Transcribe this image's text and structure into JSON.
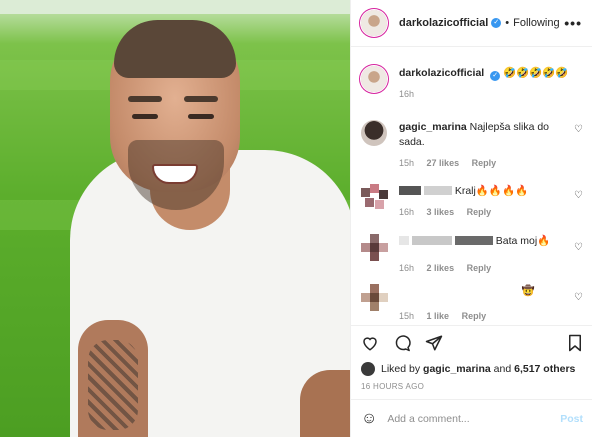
{
  "header": {
    "username": "darkolazicofficial",
    "verified_icon": "verified-badge-icon",
    "separator": "•",
    "follow_status": "Following",
    "more_label": "•••"
  },
  "caption": {
    "username": "darkolazicofficial",
    "text": "🤣🤣🤣🤣🤣",
    "time": "16h"
  },
  "comments": [
    {
      "username": "gagic_marina",
      "text": "Najlepša slika do sada.",
      "time": "15h",
      "likes": "27 likes",
      "reply": "Reply"
    },
    {
      "username": "",
      "text": "Kralj🔥🔥🔥🔥",
      "time": "16h",
      "likes": "3 likes",
      "reply": "Reply"
    },
    {
      "username": "",
      "text": "Bata moj🔥",
      "time": "16h",
      "likes": "2 likes",
      "reply": "Reply"
    },
    {
      "username": "",
      "text": "🤠",
      "time": "15h",
      "likes": "1 like",
      "reply": "Reply"
    }
  ],
  "likes": {
    "prefix": "Liked by",
    "user": "gagic_marina",
    "and": "and",
    "others": "6,517 others"
  },
  "timestamp": "16 HOURS AGO",
  "add_comment": {
    "placeholder": "Add a comment...",
    "post_label": "Post"
  },
  "colors": {
    "accent": "#3897f0",
    "post_disabled": "#b2dffc",
    "muted": "#8e8e8e"
  }
}
